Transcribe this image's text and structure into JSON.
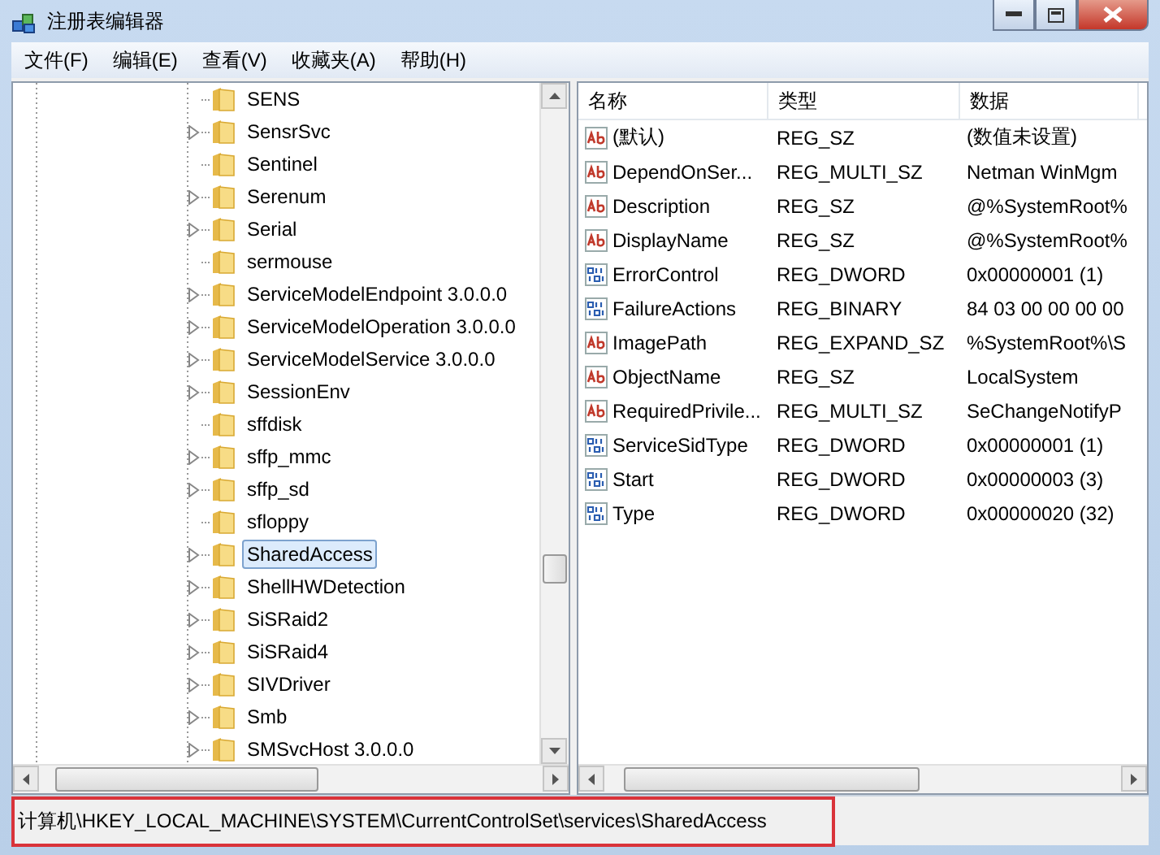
{
  "window": {
    "title": "注册表编辑器"
  },
  "menu": [
    {
      "label": "文件(F)"
    },
    {
      "label": "编辑(E)"
    },
    {
      "label": "查看(V)"
    },
    {
      "label": "收藏夹(A)"
    },
    {
      "label": "帮助(H)"
    }
  ],
  "tree": {
    "items": [
      {
        "name": "SENS",
        "expandable": false,
        "selected": false
      },
      {
        "name": "SensrSvc",
        "expandable": true,
        "selected": false
      },
      {
        "name": "Sentinel",
        "expandable": false,
        "selected": false
      },
      {
        "name": "Serenum",
        "expandable": true,
        "selected": false
      },
      {
        "name": "Serial",
        "expandable": true,
        "selected": false
      },
      {
        "name": "sermouse",
        "expandable": false,
        "selected": false
      },
      {
        "name": "ServiceModelEndpoint 3.0.0.0",
        "expandable": true,
        "selected": false
      },
      {
        "name": "ServiceModelOperation 3.0.0.0",
        "expandable": true,
        "selected": false
      },
      {
        "name": "ServiceModelService 3.0.0.0",
        "expandable": true,
        "selected": false
      },
      {
        "name": "SessionEnv",
        "expandable": true,
        "selected": false
      },
      {
        "name": "sffdisk",
        "expandable": false,
        "selected": false
      },
      {
        "name": "sffp_mmc",
        "expandable": true,
        "selected": false
      },
      {
        "name": "sffp_sd",
        "expandable": true,
        "selected": false
      },
      {
        "name": "sfloppy",
        "expandable": false,
        "selected": false
      },
      {
        "name": "SharedAccess",
        "expandable": true,
        "selected": true
      },
      {
        "name": "ShellHWDetection",
        "expandable": true,
        "selected": false
      },
      {
        "name": "SiSRaid2",
        "expandable": true,
        "selected": false
      },
      {
        "name": "SiSRaid4",
        "expandable": true,
        "selected": false
      },
      {
        "name": "SIVDriver",
        "expandable": true,
        "selected": false
      },
      {
        "name": "Smb",
        "expandable": true,
        "selected": false
      },
      {
        "name": "SMSvcHost 3.0.0.0",
        "expandable": true,
        "selected": false
      }
    ]
  },
  "values": {
    "columns": [
      "名称",
      "类型",
      "数据"
    ],
    "rows": [
      {
        "kind": "string",
        "name": "(默认)",
        "type": "REG_SZ",
        "data": "(数值未设置)"
      },
      {
        "kind": "string",
        "name": "DependOnSer...",
        "type": "REG_MULTI_SZ",
        "data": "Netman WinMgm"
      },
      {
        "kind": "string",
        "name": "Description",
        "type": "REG_SZ",
        "data": "@%SystemRoot%"
      },
      {
        "kind": "string",
        "name": "DisplayName",
        "type": "REG_SZ",
        "data": "@%SystemRoot%"
      },
      {
        "kind": "binary",
        "name": "ErrorControl",
        "type": "REG_DWORD",
        "data": "0x00000001 (1)"
      },
      {
        "kind": "binary",
        "name": "FailureActions",
        "type": "REG_BINARY",
        "data": "84 03 00 00 00 00"
      },
      {
        "kind": "string",
        "name": "ImagePath",
        "type": "REG_EXPAND_SZ",
        "data": "%SystemRoot%\\S"
      },
      {
        "kind": "string",
        "name": "ObjectName",
        "type": "REG_SZ",
        "data": "LocalSystem"
      },
      {
        "kind": "string",
        "name": "RequiredPrivile...",
        "type": "REG_MULTI_SZ",
        "data": "SeChangeNotifyP"
      },
      {
        "kind": "binary",
        "name": "ServiceSidType",
        "type": "REG_DWORD",
        "data": "0x00000001 (1)"
      },
      {
        "kind": "binary",
        "name": "Start",
        "type": "REG_DWORD",
        "data": "0x00000003 (3)"
      },
      {
        "kind": "binary",
        "name": "Type",
        "type": "REG_DWORD",
        "data": "0x00000020 (32)"
      }
    ]
  },
  "status_bar": {
    "path": "计算机\\HKEY_LOCAL_MACHINE\\SYSTEM\\CurrentControlSet\\services\\SharedAccess"
  }
}
